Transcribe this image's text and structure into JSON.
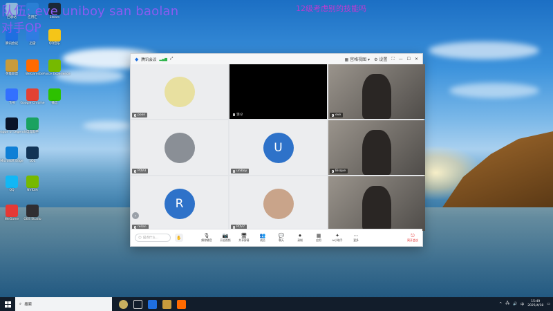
{
  "overlay": {
    "line1": "队伍: eve uniboy san baolan",
    "line2": "对手OP",
    "top_right": "12级考虑别的技能吗"
  },
  "desktop_icons": [
    {
      "label": "回收站",
      "icon": "recycle-bin-icon",
      "color": "#8fb7d9"
    },
    {
      "label": "应用汇",
      "icon": "app-icon",
      "color": "#2a7fd4"
    },
    {
      "label": "Steam",
      "icon": "steam-icon",
      "color": "#1b2838"
    },
    {
      "label": "腾讯会议",
      "icon": "meeting-icon",
      "color": "#1f6fe0"
    },
    {
      "label": "迅雷",
      "icon": "thunder-icon",
      "color": "#2f7de1"
    },
    {
      "label": "QQ音乐",
      "icon": "music-icon",
      "color": "#f5c518"
    },
    {
      "label": "英雄联盟",
      "icon": "lol-icon",
      "color": "#c89b3c"
    },
    {
      "label": "WeGame",
      "icon": "wegame-icon",
      "color": "#ff6a00"
    },
    {
      "label": "GeForce Experience",
      "icon": "nvidia-icon",
      "color": "#76b900"
    },
    {
      "label": "飞书",
      "icon": "feishu-icon",
      "color": "#3370ff"
    },
    {
      "label": "Google Chrome",
      "icon": "chrome-icon",
      "color": "#e34133"
    },
    {
      "label": "微信",
      "icon": "wechat-icon",
      "color": "#2dc100"
    },
    {
      "label": "League of Legends",
      "icon": "league-icon",
      "color": "#0a1428"
    },
    {
      "label": "电竞助手",
      "icon": "esport-icon",
      "color": "#1aa260"
    },
    {
      "label": "Microsoft Edge",
      "icon": "edge-icon",
      "color": "#0e7fd6"
    },
    {
      "label": "LOL",
      "icon": "lol2-icon",
      "color": "#123456"
    },
    {
      "label": "QQ",
      "icon": "qq-icon",
      "color": "#12b7f5"
    },
    {
      "label": "NVIDIA",
      "icon": "nvidia2-icon",
      "color": "#76b900"
    },
    {
      "label": "WeGame",
      "icon": "wegame2-icon",
      "color": "#e53935"
    },
    {
      "label": "OBS Studio",
      "icon": "obs-icon",
      "color": "#302e31"
    }
  ],
  "meeting": {
    "title": "腾讯会议",
    "signal": "▂▄▆",
    "gallery_label": "宫格视图",
    "settings_label": "设置",
    "tiles": [
      {
        "name": "poon",
        "type": "avatar-image",
        "color": "#e8e0a0"
      },
      {
        "name": "李r2",
        "type": "black"
      },
      {
        "name": "eve",
        "type": "camera"
      },
      {
        "name": "POV3",
        "type": "avatar-image",
        "color": "#8a8f96"
      },
      {
        "name": "uniboy",
        "type": "letter",
        "letter": "U"
      },
      {
        "name": "Bisque",
        "type": "camera"
      },
      {
        "name": "rellan",
        "type": "letter",
        "letter": "R"
      },
      {
        "name": "POV7",
        "type": "avatar-image",
        "color": "#c9a48a"
      },
      {
        "name": "",
        "type": "camera"
      }
    ],
    "chat_placeholder": "说点什么...",
    "toolbar": [
      {
        "label": "解除静音",
        "icon": "mic-icon",
        "glyph": "🎙"
      },
      {
        "label": "开启视频",
        "icon": "camera-icon",
        "glyph": "📷"
      },
      {
        "label": "共享屏幕",
        "icon": "share-screen-icon",
        "glyph": "🖥"
      },
      {
        "label": "成员",
        "icon": "members-icon",
        "glyph": "👥"
      },
      {
        "label": "聊天",
        "icon": "chat-icon",
        "glyph": "💬"
      },
      {
        "label": "录制",
        "icon": "record-icon",
        "glyph": "⏺"
      },
      {
        "label": "应用",
        "icon": "apps-icon",
        "glyph": "▦"
      },
      {
        "label": "AI小助手",
        "icon": "ai-icon",
        "glyph": "✦"
      },
      {
        "label": "更多",
        "icon": "more-icon",
        "glyph": "⋯"
      }
    ],
    "leave_label": "离开会议"
  },
  "taskbar": {
    "search_placeholder": "搜索",
    "time": "15:49",
    "date": "2025/4/18",
    "lang": "中"
  }
}
